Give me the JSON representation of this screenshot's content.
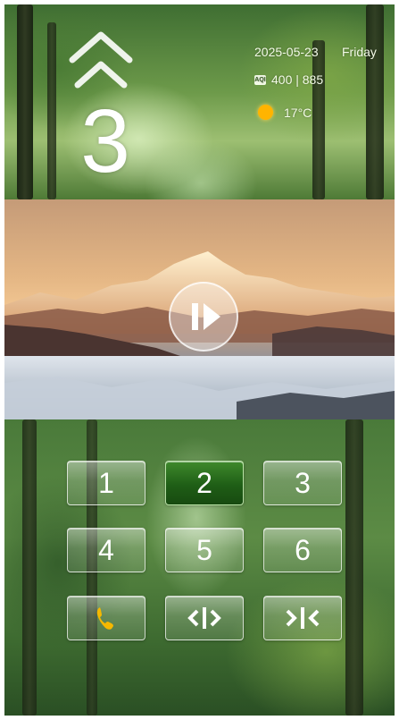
{
  "header": {
    "floor_number": "3",
    "direction_icon": "double-chevron-up-icon",
    "date": "2025-05-23",
    "weekday": "Friday",
    "aqi_icon_label": "AQI",
    "aqi_value": "400 | 885",
    "weather_icon": "sun-icon",
    "temperature": "17°C"
  },
  "video": {
    "play_icon": "play-pause-icon"
  },
  "keypad": {
    "keys": [
      {
        "label": "1",
        "active": false
      },
      {
        "label": "2",
        "active": true
      },
      {
        "label": "3",
        "active": false
      },
      {
        "label": "4",
        "active": false
      },
      {
        "label": "5",
        "active": false
      },
      {
        "label": "6",
        "active": false
      }
    ],
    "phone_icon": "phone-icon",
    "phone_color": "#f5b800",
    "door_open_icon": "door-open-icon",
    "door_close_icon": "door-close-icon"
  }
}
